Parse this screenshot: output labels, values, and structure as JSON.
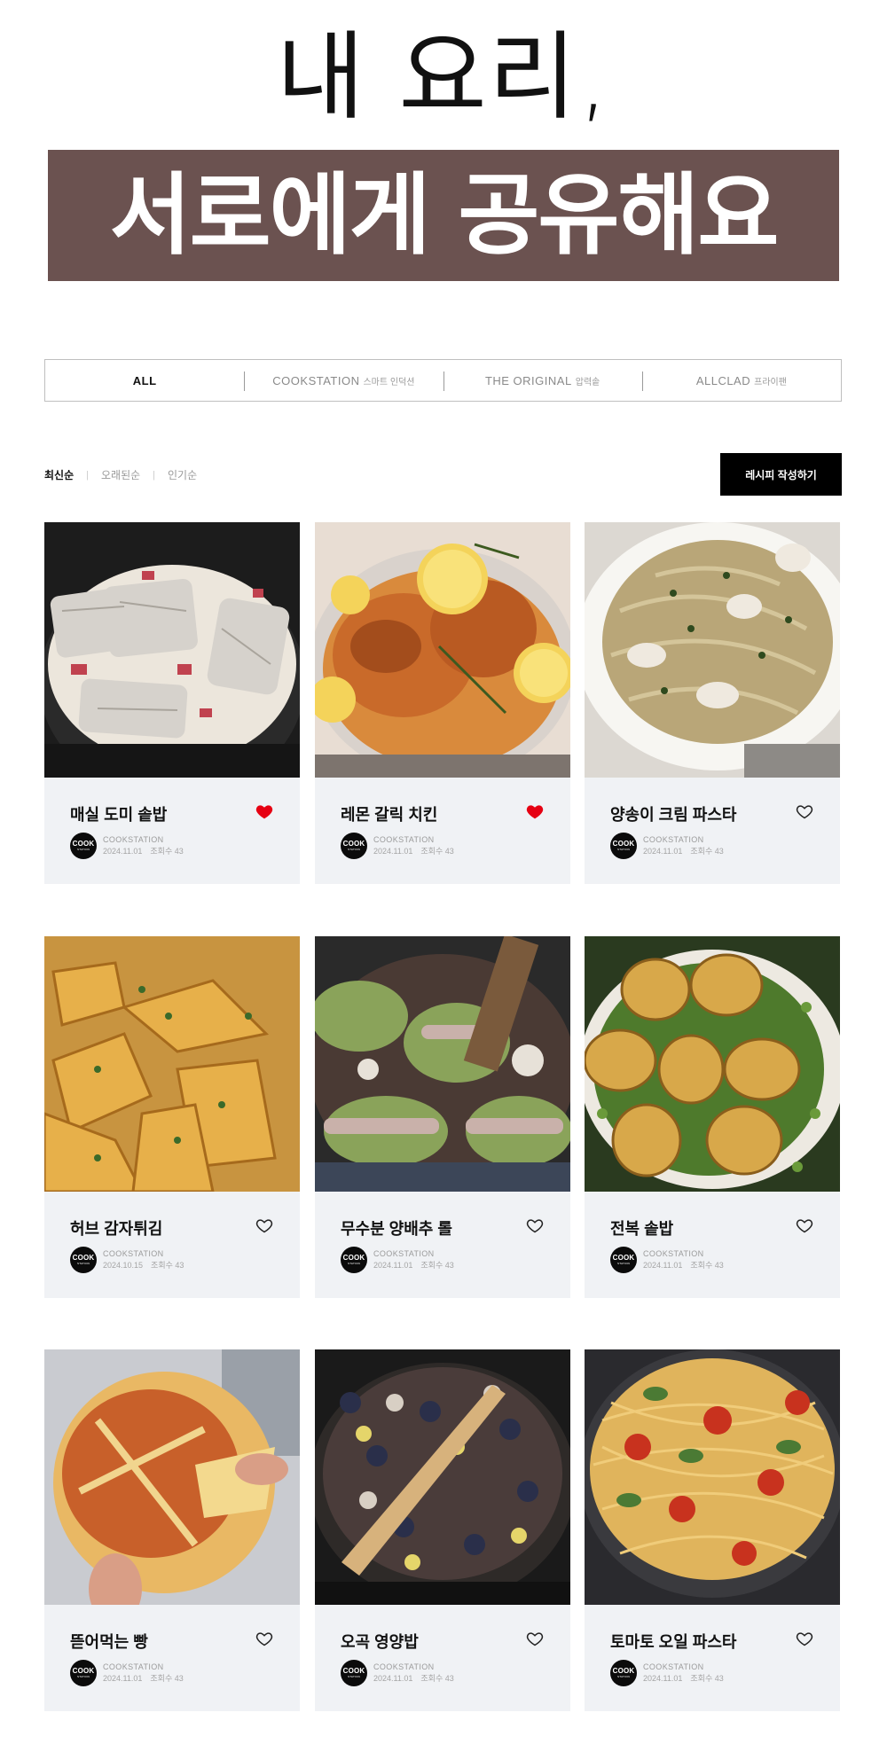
{
  "hero": {
    "line1": "내 요리,",
    "line2": "서로에게 공유해요",
    "band_color": "#6b5250"
  },
  "tabs": [
    {
      "brand": "ALL",
      "sub": "",
      "active": true
    },
    {
      "brand": "COOKSTATION",
      "sub": "스마트 인덕션",
      "active": false
    },
    {
      "brand": "THE ORIGINAL",
      "sub": "압력솥",
      "active": false
    },
    {
      "brand": "ALLCLAD",
      "sub": "프라이팬",
      "active": false
    }
  ],
  "sort": {
    "options": [
      "최신순",
      "오래된순",
      "인기순"
    ],
    "active": "최신순"
  },
  "write_button": "레시피 작성하기",
  "accent_colors": {
    "liked_heart": "#e60012",
    "button": "#000000",
    "card_bg": "#f0f2f5"
  },
  "cards": [
    {
      "title": "매실 도미 솥밥",
      "liked": true,
      "author": "COOKSTATION",
      "date": "2024.11.01",
      "views": "조회수 43"
    },
    {
      "title": "레몬 갈릭 치킨",
      "liked": true,
      "author": "COOKSTATION",
      "date": "2024.11.01",
      "views": "조회수 43"
    },
    {
      "title": "양송이 크림 파스타",
      "liked": false,
      "author": "COOKSTATION",
      "date": "2024.11.01",
      "views": "조회수 43"
    },
    {
      "title": "허브 감자튀김",
      "liked": false,
      "author": "COOKSTATION",
      "date": "2024.10.15",
      "views": "조회수 43"
    },
    {
      "title": "무수분 양배추 롤",
      "liked": false,
      "author": "COOKSTATION",
      "date": "2024.11.01",
      "views": "조회수 43"
    },
    {
      "title": "전복 솥밥",
      "liked": false,
      "author": "COOKSTATION",
      "date": "2024.11.01",
      "views": "조회수 43"
    },
    {
      "title": "뜯어먹는 빵",
      "liked": false,
      "author": "COOKSTATION",
      "date": "2024.11.01",
      "views": "조회수 43"
    },
    {
      "title": "오곡 영양밥",
      "liked": false,
      "author": "COOKSTATION",
      "date": "2024.11.01",
      "views": "조회수 43"
    },
    {
      "title": "토마토 오일 파스타",
      "liked": false,
      "author": "COOKSTATION",
      "date": "2024.11.01",
      "views": "조회수 43"
    }
  ],
  "avatar_logo": {
    "line1": "COOK",
    "line2": "STATION"
  }
}
